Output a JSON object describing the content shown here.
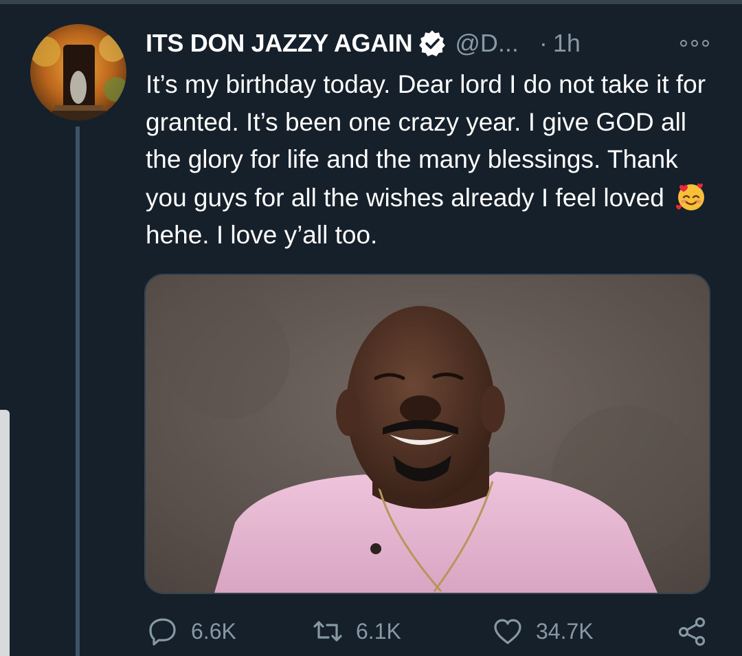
{
  "tweet": {
    "author": {
      "display_name": "ITS DON JAZZY AGAIN",
      "handle": "@D...",
      "verified": true
    },
    "time_separator": "·",
    "time": "1h",
    "text_before_emoji": "It’s my birthday today. Dear lord I do not take it for granted. It’s been one crazy year. I give GOD all the glory for life and the many blessings. Thank you guys for all the wishes already I feel loved",
    "emoji": "smiling-face-with-hearts",
    "text_after_emoji": "hehe. I love y’all too.",
    "media": {
      "type": "photo"
    }
  },
  "actions": {
    "reply_count": "6.6K",
    "retweet_count": "6.1K",
    "like_count": "34.7K"
  },
  "colors": {
    "background": "#15202b",
    "secondary_text": "#8899a6",
    "border": "#38444d"
  }
}
